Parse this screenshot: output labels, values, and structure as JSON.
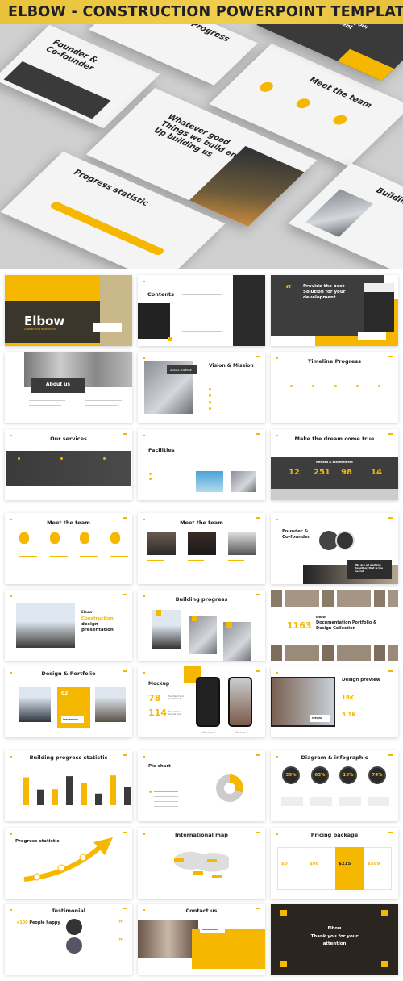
{
  "header": {
    "title": "ELBOW - CONSTRUCTION POWERPOINT TEMPLATE"
  },
  "colors": {
    "accent": "#f5b700",
    "dark": "#3a3a3a",
    "background": "#ffffff"
  },
  "hero": {
    "founder": "Founder & Co-founder",
    "team": "Meet the team",
    "quote": "Whatever good Things we build end Up building us",
    "progress": "Progress statistic",
    "building": "Building pro",
    "provide": "Provide the best Solution for your development",
    "timeline": "Progress"
  },
  "slides": {
    "cover": {
      "brand": "Elbow",
      "subtitle": "CONSTRUCTION PRESENTATION"
    },
    "contents": {
      "title": "Contents"
    },
    "provide": {
      "title": "Provide the best Solution for your development",
      "quote_icon": "quote-icon"
    },
    "about": {
      "title": "About us"
    },
    "vision": {
      "title": "Vision & Mission",
      "badge": "GOAL & PURPOSE"
    },
    "timeline": {
      "title": "Timeline Progress"
    },
    "services": {
      "title": "Our services"
    },
    "facilities": {
      "title": "Facilities"
    },
    "dream": {
      "title": "Make the dream come true",
      "banner": "Reward & achievement",
      "stats": [
        "12",
        "251",
        "98",
        "14"
      ]
    },
    "team1": {
      "title": "Meet the team"
    },
    "team2": {
      "title": "Meet the team"
    },
    "founder": {
      "title": "Founder & Co-founder",
      "quote": "We are all working together, that is the secret"
    },
    "construction": {
      "brand": "Elbow",
      "title_accent": "Construction",
      "title_rest": " design presentation"
    },
    "building": {
      "title": "Building progress"
    },
    "documentation": {
      "number": "1163",
      "brand": "Elbow",
      "title": "Documentation Portfolio & Design Collection"
    },
    "portfolio": {
      "title": "Design & Portfolio",
      "number": "02",
      "button": "DESCRIPTION"
    },
    "mockup": {
      "title": "Mockup",
      "stats": [
        "78",
        "114"
      ],
      "labels": [
        "The project and development",
        "The number projects done"
      ],
      "captions": [
        "Mockup 1",
        "Mockup 2"
      ]
    },
    "preview": {
      "title": "Design preview",
      "stats": [
        "18K",
        "3.1K"
      ],
      "button": "PREVIEW"
    },
    "bar": {
      "title": "Building progress statistic"
    },
    "pie": {
      "title": "Pie chart"
    },
    "diagram": {
      "title": "Diagram & infographic",
      "stats": [
        "35%",
        "63%",
        "16%",
        "74%"
      ]
    },
    "progress": {
      "title": "Progress statistic"
    },
    "map": {
      "title": "International map"
    },
    "pricing": {
      "title": "Pricing package",
      "prices": [
        "$0",
        "$98",
        "$215",
        "$599"
      ]
    },
    "testimonial": {
      "title": "Testimonial",
      "highlight": "+100",
      "rest": " People happy"
    },
    "contact": {
      "title": "Contact us",
      "badge": "INFORMATION"
    },
    "thanks": {
      "brand": "Elbow",
      "title": "Thank you for your attention"
    }
  },
  "chart_data": {
    "type": "bar",
    "values": [
      0.75,
      0.42,
      0.43,
      0.78,
      0.6,
      0.31,
      0.8,
      0.49
    ],
    "colors": [
      "#f5b700",
      "#3a3a3a",
      "#f5b700",
      "#3a3a3a",
      "#f5b700",
      "#3a3a3a",
      "#f5b700",
      "#3a3a3a"
    ]
  }
}
